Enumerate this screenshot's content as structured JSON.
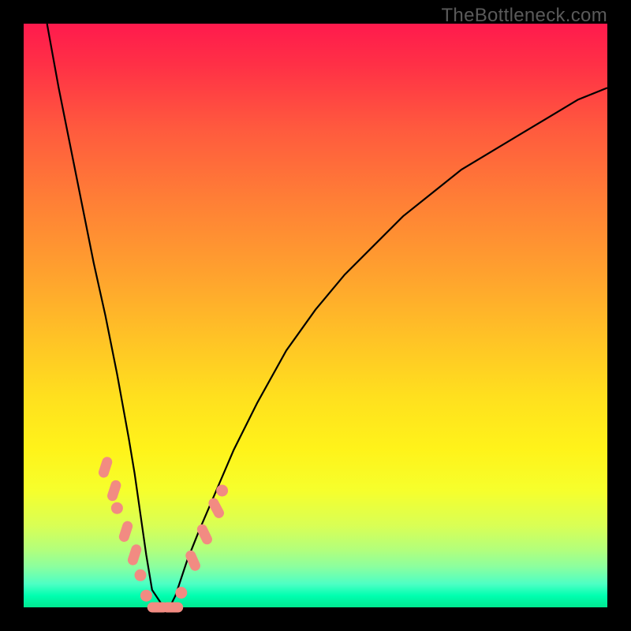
{
  "watermark": "TheBottleneck.com",
  "colors": {
    "frame": "#000000",
    "curve": "#000000",
    "marker_fill": "#f28b82",
    "marker_stroke": "#e06666"
  },
  "chart_data": {
    "type": "line",
    "title": "",
    "xlabel": "",
    "ylabel": "",
    "xlim": [
      0,
      100
    ],
    "ylim": [
      0,
      100
    ],
    "series": [
      {
        "name": "curve",
        "x": [
          4,
          6,
          8,
          10,
          12,
          14,
          16,
          18,
          19,
          20,
          21,
          22,
          24,
          25,
          26,
          28,
          30,
          33,
          36,
          40,
          45,
          50,
          55,
          60,
          65,
          70,
          75,
          80,
          85,
          90,
          95,
          100
        ],
        "y": [
          100,
          89,
          79,
          69,
          59,
          50,
          40,
          29,
          23,
          16,
          9,
          3,
          0,
          0,
          2,
          8,
          13,
          20,
          27,
          35,
          44,
          51,
          57,
          62,
          67,
          71,
          75,
          78,
          81,
          84,
          87,
          89
        ]
      }
    ],
    "markers": [
      {
        "x": 14.0,
        "y": 24.0,
        "shape": "capsule",
        "angle": -72
      },
      {
        "x": 15.5,
        "y": 20.0,
        "shape": "capsule",
        "angle": -72
      },
      {
        "x": 16.0,
        "y": 17.0,
        "shape": "round"
      },
      {
        "x": 17.5,
        "y": 13.0,
        "shape": "capsule",
        "angle": -72
      },
      {
        "x": 19.0,
        "y": 9.0,
        "shape": "capsule",
        "angle": -72
      },
      {
        "x": 20.0,
        "y": 5.5,
        "shape": "round"
      },
      {
        "x": 21.0,
        "y": 2.0,
        "shape": "round"
      },
      {
        "x": 23.0,
        "y": 0.0,
        "shape": "capsule",
        "angle": 0
      },
      {
        "x": 25.5,
        "y": 0.0,
        "shape": "capsule",
        "angle": 0
      },
      {
        "x": 27.0,
        "y": 2.5,
        "shape": "round"
      },
      {
        "x": 29.0,
        "y": 8.0,
        "shape": "capsule",
        "angle": 66
      },
      {
        "x": 31.0,
        "y": 12.5,
        "shape": "capsule",
        "angle": 64
      },
      {
        "x": 33.0,
        "y": 17.0,
        "shape": "capsule",
        "angle": 62
      },
      {
        "x": 34.0,
        "y": 20.0,
        "shape": "round"
      }
    ]
  }
}
